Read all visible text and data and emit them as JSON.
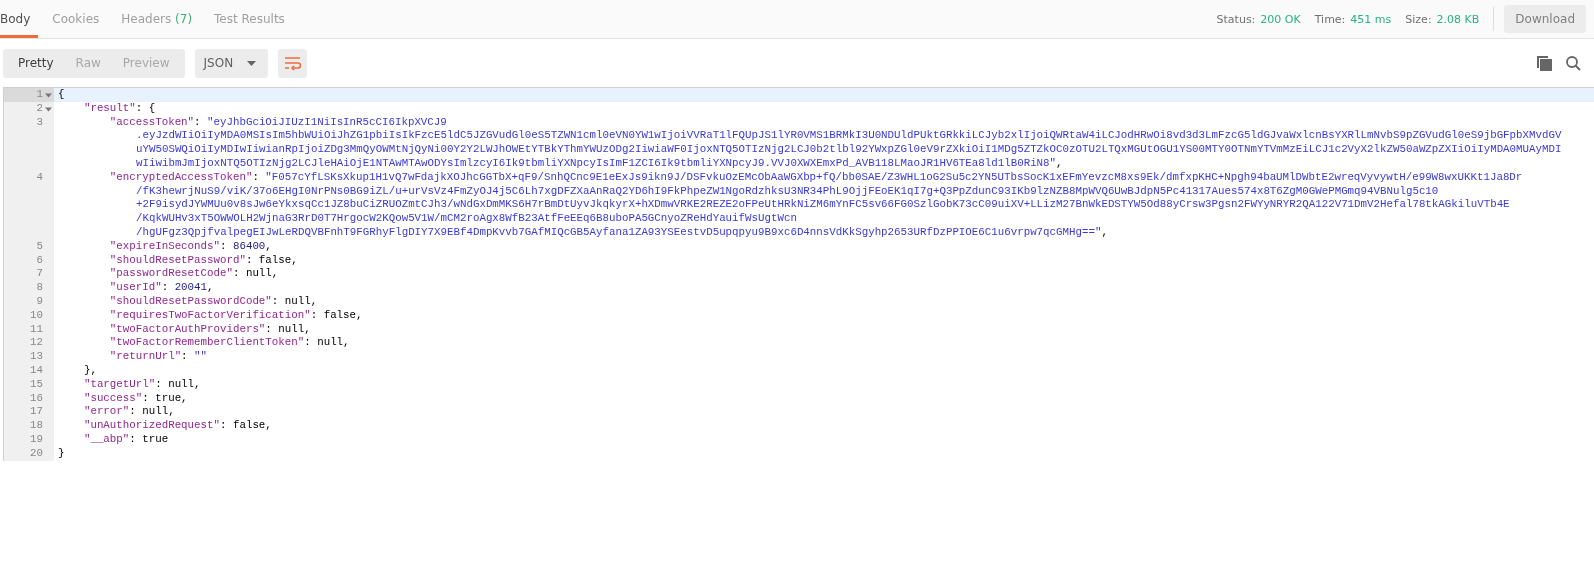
{
  "tabs": [
    {
      "label": "Body",
      "selected": true
    },
    {
      "label": "Cookies",
      "selected": false
    },
    {
      "label": "Headers",
      "count": "(7)",
      "selected": false
    },
    {
      "label": "Test Results",
      "selected": false
    }
  ],
  "stats": [
    {
      "label": "Status:",
      "value": "200 OK"
    },
    {
      "label": "Time:",
      "value": "451 ms"
    },
    {
      "label": "Size:",
      "value": "2.08 KB"
    }
  ],
  "download_button": "Download",
  "view_modes": [
    {
      "label": "Pretty",
      "selected": true
    },
    {
      "label": "Raw",
      "selected": false
    },
    {
      "label": "Preview",
      "selected": false
    }
  ],
  "format_dropdown": {
    "value": "JSON"
  },
  "wrap_enabled": true,
  "code_lines": [
    {
      "number": "1",
      "foldable": true,
      "active": true,
      "tokens": [
        {
          "kind": "punct",
          "text": "{"
        }
      ]
    },
    {
      "number": "2",
      "foldable": true,
      "active": false,
      "tokens": [
        {
          "kind": "key",
          "text": "    \"result\""
        },
        {
          "kind": "punct",
          "text": ": {"
        }
      ]
    },
    {
      "number": "3",
      "foldable": false,
      "active": false,
      "tokens": [
        {
          "kind": "key",
          "text": "        \"accessToken\""
        },
        {
          "kind": "punct",
          "text": ": "
        },
        {
          "kind": "string",
          "text": "\"eyJhbGciOiJIUzI1NiIsInR5cCI6IkpXVCJ9",
          "continuation": [
            ".eyJzdWIiOiIyMDA0MSIsIm5hbWUiOiJhZG1pbiIsIkFzcE5ldC5JZGVudGl0eS5TZWN1cml0eVN0YW1wIjoiVVRaT1lFQUpJS1lYR0VMS1BRMkI3U0NDUldPUktGRkkiLCJyb2xlIjoiQWRtaW4iLCJodHRwOi8vd3d3LmFzcG5ldGJvaWxlcnBsYXRlLmNvbS9pZGVudGl0eS9jbGFpbXMvdGV",
            "uYW50SWQiOiIyMDIwIiwianRpIjoiZDg3MmQyOWMtNjQyNi00Y2Y2LWJhOWEtYTBkYThmYWUzODg2IiwiaWF0IjoxNTQ5OTIzNjg2LCJ0b2tlbl92YWxpZGl0eV9rZXkiOiI1MDg5ZTZkOC0zOTU2LTQxMGUtOGU1YS00MTY0OTNmYTVmMzEiLCJ1c2VyX2lkZW50aWZpZXIiOiIyMDA0MUAyMDI",
            "wIiwibmJmIjoxNTQ5OTIzNjg2LCJleHAiOjE1NTAwMTAwODYsImlzcyI6Ik9tbmliYXNpcyIsImF1ZCI6Ik9tbmliYXNpcyJ9.VVJ0XWXEmxPd_AVB118LMaoJR1HV6TEa8ld1lB0RiN8\""
          ]
        },
        {
          "kind": "punct",
          "text": ","
        }
      ]
    },
    {
      "number": "4",
      "foldable": false,
      "active": false,
      "tokens": [
        {
          "kind": "key",
          "text": "        \"encryptedAccessToken\""
        },
        {
          "kind": "punct",
          "text": ": "
        },
        {
          "kind": "string",
          "text": "\"F057cYfLSKsXkup1H1vQ7wFdajkXOJhcGGTbX+qF9/SnhQCnc9E1eExJs9ikn9J/DSFvkuOzEMcObAaWGXbp+fQ/bb0SAE/Z3WHL1oG2Su5c2YN5UTbsSocK1xEFmYevzcM8xs9Ek/dmfxpKHC+Npgh94baUMlDWbtE2wreqVyvywtH/e99W8wxUKKt1Ja8Dr",
          "continuation": [
            "/fK3hewrjNuS9/viK/37o6EHgI0NrPNs0BG9iZL/u+urVsVz4FmZyOJ4j5C6Lh7xgDFZXaAnRaQ2YD6hI9FkPhpeZW1NgoRdzhksU3NR34PhL9OjjFEoEK1qI7g+Q3PpZdunC93IKb9lzNZB8MpWVQ6UwBJdpN5Pc41317Aues574x8T6ZgM0GWePMGmq94VBNulg5c10",
            "+2F9isydJYWMUu0v8sJw6eYkxsqCc1JZ8buCiZRUOZmtCJh3/wNdGxDmMKS6H7rBmDtUyvJkqkyrX+hXDmwVRKE2REZE2oFPeUtHRkNiZM6mYnFC5sv66FG0SzlGobK73cC09uiXV+LLizM27BnWkEDSTYW5Od88yCrsw3Pgsn2FWYyNRYR2QA122V71DmV2Hefal78tkAGkiluVTb4E",
            "/KqkWUHv3xT5OWWOLH2WjnaG3RrD0T7HrgocW2KQow5V1W/mCM2roAgx8WfB23AtfFeEEq6B8uboPA5GCnyoZReHdYauifWsUgtWcn",
            "/hgUFgz3QpjfvalpegEIJwLeRDQVBFnhT9FGRhyFlgDIY7X9EBf4DmpKvvb7GAfMIQcGB5Ayfana1ZA93YSEestvD5upqpyu9B9xc6D4nnsVdKkSgyhp2653URfDzPPIOE6C1u6vrpw7qcGMHg==\""
          ]
        },
        {
          "kind": "punct",
          "text": ","
        }
      ]
    },
    {
      "number": "5",
      "foldable": false,
      "active": false,
      "tokens": [
        {
          "kind": "key",
          "text": "        \"expireInSeconds\""
        },
        {
          "kind": "punct",
          "text": ": "
        },
        {
          "kind": "number",
          "text": "86400"
        },
        {
          "kind": "punct",
          "text": ","
        }
      ]
    },
    {
      "number": "6",
      "foldable": false,
      "active": false,
      "tokens": [
        {
          "kind": "key",
          "text": "        \"shouldResetPassword\""
        },
        {
          "kind": "punct",
          "text": ": false,"
        }
      ]
    },
    {
      "number": "7",
      "foldable": false,
      "active": false,
      "tokens": [
        {
          "kind": "key",
          "text": "        \"passwordResetCode\""
        },
        {
          "kind": "punct",
          "text": ": null,"
        }
      ]
    },
    {
      "number": "8",
      "foldable": false,
      "active": false,
      "tokens": [
        {
          "kind": "key",
          "text": "        \"userId\""
        },
        {
          "kind": "punct",
          "text": ": "
        },
        {
          "kind": "number",
          "text": "20041"
        },
        {
          "kind": "punct",
          "text": ","
        }
      ]
    },
    {
      "number": "9",
      "foldable": false,
      "active": false,
      "tokens": [
        {
          "kind": "key",
          "text": "        \"shouldResetPasswordCode\""
        },
        {
          "kind": "punct",
          "text": ": null,"
        }
      ]
    },
    {
      "number": "10",
      "foldable": false,
      "active": false,
      "tokens": [
        {
          "kind": "key",
          "text": "        \"requiresTwoFactorVerification\""
        },
        {
          "kind": "punct",
          "text": ": false,"
        }
      ]
    },
    {
      "number": "11",
      "foldable": false,
      "active": false,
      "tokens": [
        {
          "kind": "key",
          "text": "        \"twoFactorAuthProviders\""
        },
        {
          "kind": "punct",
          "text": ": null,"
        }
      ]
    },
    {
      "number": "12",
      "foldable": false,
      "active": false,
      "tokens": [
        {
          "kind": "key",
          "text": "        \"twoFactorRememberClientToken\""
        },
        {
          "kind": "punct",
          "text": ": null,"
        }
      ]
    },
    {
      "number": "13",
      "foldable": false,
      "active": false,
      "tokens": [
        {
          "kind": "key",
          "text": "        \"returnUrl\""
        },
        {
          "kind": "punct",
          "text": ": "
        },
        {
          "kind": "string",
          "text": "\"\""
        }
      ]
    },
    {
      "number": "14",
      "foldable": false,
      "active": false,
      "tokens": [
        {
          "kind": "punct",
          "text": "    },"
        }
      ]
    },
    {
      "number": "15",
      "foldable": false,
      "active": false,
      "tokens": [
        {
          "kind": "key",
          "text": "    \"targetUrl\""
        },
        {
          "kind": "punct",
          "text": ": null,"
        }
      ]
    },
    {
      "number": "16",
      "foldable": false,
      "active": false,
      "tokens": [
        {
          "kind": "key",
          "text": "    \"success\""
        },
        {
          "kind": "punct",
          "text": ": true,"
        }
      ]
    },
    {
      "number": "17",
      "foldable": false,
      "active": false,
      "tokens": [
        {
          "kind": "key",
          "text": "    \"error\""
        },
        {
          "kind": "punct",
          "text": ": null,"
        }
      ]
    },
    {
      "number": "18",
      "foldable": false,
      "active": false,
      "tokens": [
        {
          "kind": "key",
          "text": "    \"unAuthorizedRequest\""
        },
        {
          "kind": "punct",
          "text": ": false,"
        }
      ]
    },
    {
      "number": "19",
      "foldable": false,
      "active": false,
      "tokens": [
        {
          "kind": "key",
          "text": "    \"__abp\""
        },
        {
          "kind": "punct",
          "text": ": true"
        }
      ]
    },
    {
      "number": "20",
      "foldable": false,
      "active": false,
      "tokens": [
        {
          "kind": "punct",
          "text": "}"
        }
      ]
    }
  ]
}
